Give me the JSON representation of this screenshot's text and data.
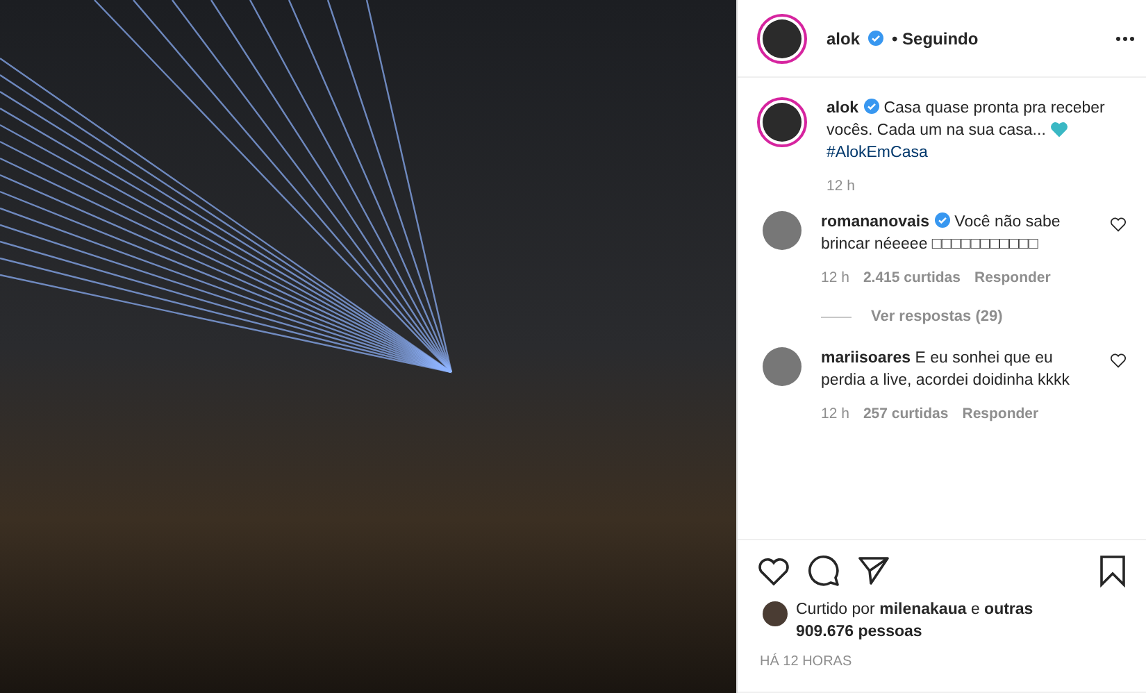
{
  "post": {
    "author": "alok",
    "verified": true,
    "follow_status": "• Seguindo"
  },
  "caption": {
    "author": "alok",
    "verified": true,
    "text": "Casa quase pronta pra receber vocês. Cada um na sua casa...",
    "hashtag": "#AlokEmCasa",
    "time": "12 h"
  },
  "comments": [
    {
      "author": "romananovais",
      "verified": true,
      "text": "Você não sabe brincar néeeee □□□□□□□□□□□",
      "time": "12 h",
      "likes": "2.415 curtidas",
      "reply": "Responder",
      "replies": "Ver respostas (29)"
    },
    {
      "author": "mariisoares",
      "verified": false,
      "text": "E eu sonhei que eu perdia a live, acordei doidinha kkkk",
      "time": "12 h",
      "likes": "257 curtidas",
      "reply": "Responder"
    }
  ],
  "liked_by": "Curtido por **milenakaua** e **outras 909.676 pessoas**",
  "timestamp": "HÁ 12 HORAS"
}
